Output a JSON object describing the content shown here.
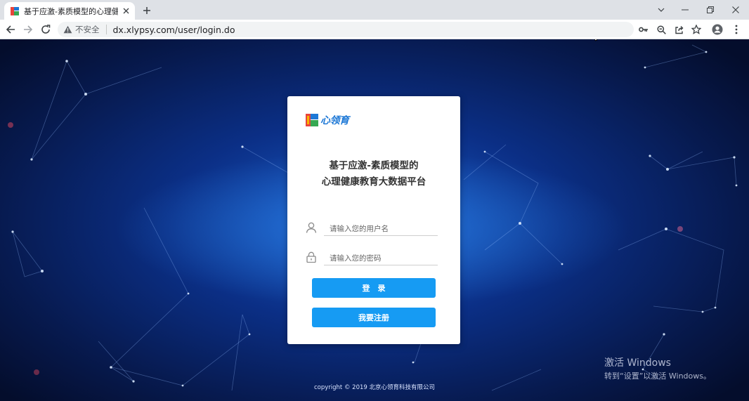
{
  "browser": {
    "tab": {
      "title": "基于应激-素质模型的心理健康教育大数据平台"
    },
    "omnibox": {
      "security_label": "不安全",
      "url": "dx.xlypsy.com/user/login.do"
    }
  },
  "login": {
    "brand": "心领育",
    "title_line1": "基于应激-素质模型的",
    "title_line2": "心理健康教育大数据平台",
    "username_placeholder": "请输入您的用户名",
    "password_placeholder": "请输入您的密码",
    "login_label": "登　录",
    "register_label": "我要注册"
  },
  "footer": {
    "copyright": "copyright © 2019 北京心领育科技有限公司"
  },
  "watermark": {
    "line1": "激活 Windows",
    "line2": "转到“设置”以激活 Windows。"
  },
  "colors": {
    "primary_button": "#169bf3",
    "brand": "#1d78d6",
    "page_background": "#0b2f86"
  }
}
